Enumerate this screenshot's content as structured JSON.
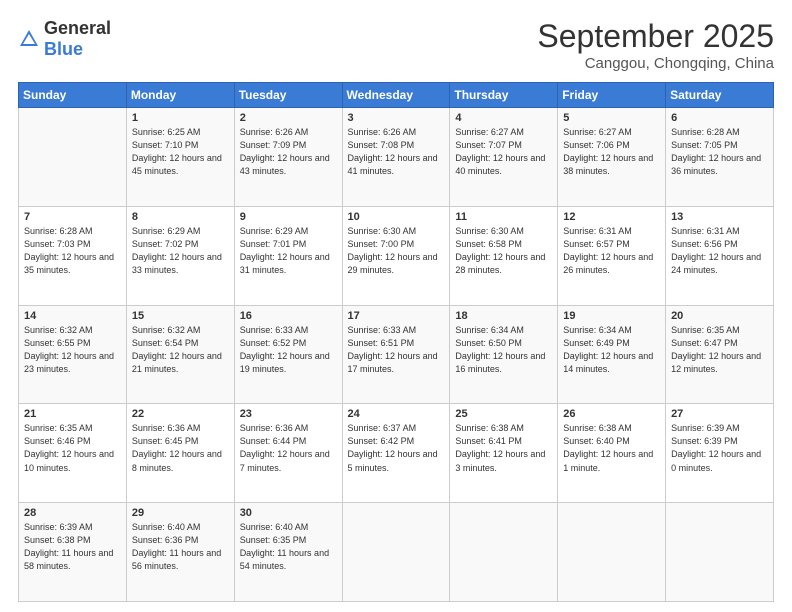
{
  "logo": {
    "general": "General",
    "blue": "Blue"
  },
  "title": {
    "month": "September 2025",
    "location": "Canggou, Chongqing, China"
  },
  "headers": [
    "Sunday",
    "Monday",
    "Tuesday",
    "Wednesday",
    "Thursday",
    "Friday",
    "Saturday"
  ],
  "weeks": [
    [
      {
        "day": "",
        "info": ""
      },
      {
        "day": "1",
        "info": "Sunrise: 6:25 AM\nSunset: 7:10 PM\nDaylight: 12 hours and 45 minutes."
      },
      {
        "day": "2",
        "info": "Sunrise: 6:26 AM\nSunset: 7:09 PM\nDaylight: 12 hours and 43 minutes."
      },
      {
        "day": "3",
        "info": "Sunrise: 6:26 AM\nSunset: 7:08 PM\nDaylight: 12 hours and 41 minutes."
      },
      {
        "day": "4",
        "info": "Sunrise: 6:27 AM\nSunset: 7:07 PM\nDaylight: 12 hours and 40 minutes."
      },
      {
        "day": "5",
        "info": "Sunrise: 6:27 AM\nSunset: 7:06 PM\nDaylight: 12 hours and 38 minutes."
      },
      {
        "day": "6",
        "info": "Sunrise: 6:28 AM\nSunset: 7:05 PM\nDaylight: 12 hours and 36 minutes."
      }
    ],
    [
      {
        "day": "7",
        "info": "Sunrise: 6:28 AM\nSunset: 7:03 PM\nDaylight: 12 hours and 35 minutes."
      },
      {
        "day": "8",
        "info": "Sunrise: 6:29 AM\nSunset: 7:02 PM\nDaylight: 12 hours and 33 minutes."
      },
      {
        "day": "9",
        "info": "Sunrise: 6:29 AM\nSunset: 7:01 PM\nDaylight: 12 hours and 31 minutes."
      },
      {
        "day": "10",
        "info": "Sunrise: 6:30 AM\nSunset: 7:00 PM\nDaylight: 12 hours and 29 minutes."
      },
      {
        "day": "11",
        "info": "Sunrise: 6:30 AM\nSunset: 6:58 PM\nDaylight: 12 hours and 28 minutes."
      },
      {
        "day": "12",
        "info": "Sunrise: 6:31 AM\nSunset: 6:57 PM\nDaylight: 12 hours and 26 minutes."
      },
      {
        "day": "13",
        "info": "Sunrise: 6:31 AM\nSunset: 6:56 PM\nDaylight: 12 hours and 24 minutes."
      }
    ],
    [
      {
        "day": "14",
        "info": "Sunrise: 6:32 AM\nSunset: 6:55 PM\nDaylight: 12 hours and 23 minutes."
      },
      {
        "day": "15",
        "info": "Sunrise: 6:32 AM\nSunset: 6:54 PM\nDaylight: 12 hours and 21 minutes."
      },
      {
        "day": "16",
        "info": "Sunrise: 6:33 AM\nSunset: 6:52 PM\nDaylight: 12 hours and 19 minutes."
      },
      {
        "day": "17",
        "info": "Sunrise: 6:33 AM\nSunset: 6:51 PM\nDaylight: 12 hours and 17 minutes."
      },
      {
        "day": "18",
        "info": "Sunrise: 6:34 AM\nSunset: 6:50 PM\nDaylight: 12 hours and 16 minutes."
      },
      {
        "day": "19",
        "info": "Sunrise: 6:34 AM\nSunset: 6:49 PM\nDaylight: 12 hours and 14 minutes."
      },
      {
        "day": "20",
        "info": "Sunrise: 6:35 AM\nSunset: 6:47 PM\nDaylight: 12 hours and 12 minutes."
      }
    ],
    [
      {
        "day": "21",
        "info": "Sunrise: 6:35 AM\nSunset: 6:46 PM\nDaylight: 12 hours and 10 minutes."
      },
      {
        "day": "22",
        "info": "Sunrise: 6:36 AM\nSunset: 6:45 PM\nDaylight: 12 hours and 8 minutes."
      },
      {
        "day": "23",
        "info": "Sunrise: 6:36 AM\nSunset: 6:44 PM\nDaylight: 12 hours and 7 minutes."
      },
      {
        "day": "24",
        "info": "Sunrise: 6:37 AM\nSunset: 6:42 PM\nDaylight: 12 hours and 5 minutes."
      },
      {
        "day": "25",
        "info": "Sunrise: 6:38 AM\nSunset: 6:41 PM\nDaylight: 12 hours and 3 minutes."
      },
      {
        "day": "26",
        "info": "Sunrise: 6:38 AM\nSunset: 6:40 PM\nDaylight: 12 hours and 1 minute."
      },
      {
        "day": "27",
        "info": "Sunrise: 6:39 AM\nSunset: 6:39 PM\nDaylight: 12 hours and 0 minutes."
      }
    ],
    [
      {
        "day": "28",
        "info": "Sunrise: 6:39 AM\nSunset: 6:38 PM\nDaylight: 11 hours and 58 minutes."
      },
      {
        "day": "29",
        "info": "Sunrise: 6:40 AM\nSunset: 6:36 PM\nDaylight: 11 hours and 56 minutes."
      },
      {
        "day": "30",
        "info": "Sunrise: 6:40 AM\nSunset: 6:35 PM\nDaylight: 11 hours and 54 minutes."
      },
      {
        "day": "",
        "info": ""
      },
      {
        "day": "",
        "info": ""
      },
      {
        "day": "",
        "info": ""
      },
      {
        "day": "",
        "info": ""
      }
    ]
  ]
}
